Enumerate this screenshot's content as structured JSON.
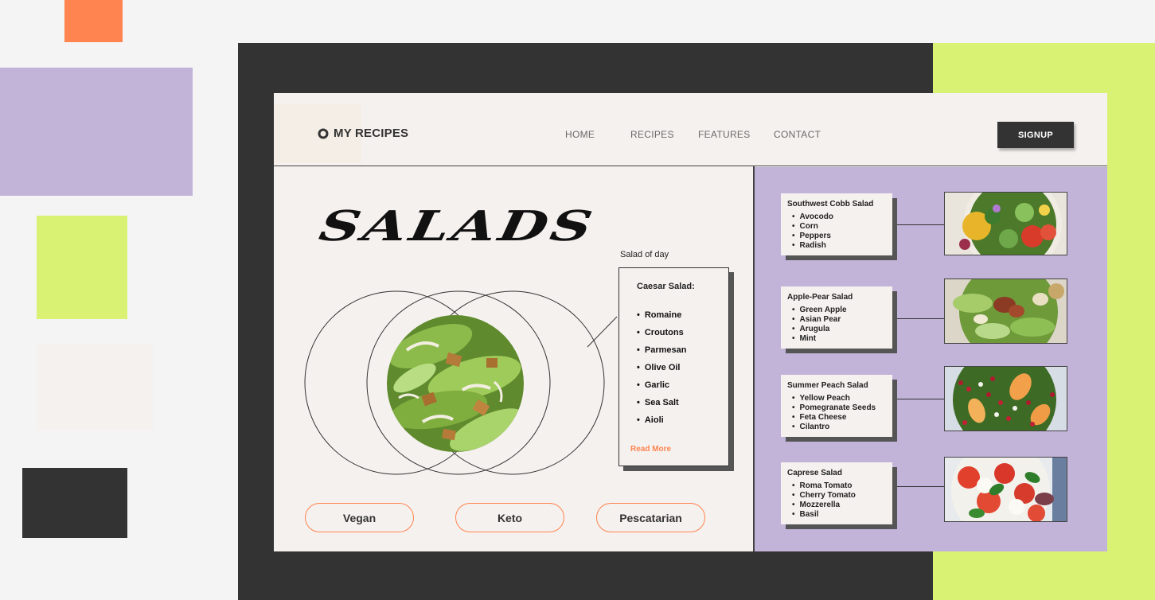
{
  "palette": {
    "orange": "#ff8450",
    "lavender": "#c2b3d9",
    "lime": "#d9f274",
    "cream": "#f5f1ee",
    "charcoal": "#333333"
  },
  "header": {
    "brand": "MY RECIPES",
    "brand_icon": "ring-logo-icon",
    "nav": [
      "HOME",
      "RECIPES",
      "FEATURES",
      "CONTACT"
    ],
    "signup": "SIGNUP"
  },
  "hero": {
    "title": "SALADS",
    "salad_of_day_label": "Salad of day",
    "feature": {
      "title": "Caesar Salad:",
      "ingredients": [
        "Romaine",
        "Croutons",
        "Parmesan",
        "Olive Oil",
        "Garlic",
        "Sea Salt",
        "Aioli"
      ],
      "read_more": "Read More"
    }
  },
  "filters": [
    "Vegan",
    "Keto",
    "Pescatarian"
  ],
  "salads": [
    {
      "title": "Southwest Cobb Salad",
      "ingredients": [
        "Avocodo",
        "Corn",
        "Peppers",
        "Radish"
      ]
    },
    {
      "title": "Apple-Pear Salad",
      "ingredients": [
        "Green Apple",
        "Asian Pear",
        "Arugula",
        "Mint"
      ]
    },
    {
      "title": "Summer Peach Salad",
      "ingredients": [
        "Yellow Peach",
        "Pomegranate Seeds",
        "Feta Cheese",
        "Cilantro"
      ]
    },
    {
      "title": "Caprese Salad",
      "ingredients": [
        "Roma Tomato",
        "Cherry Tomato",
        "Mozzerella",
        "Basil"
      ]
    }
  ]
}
